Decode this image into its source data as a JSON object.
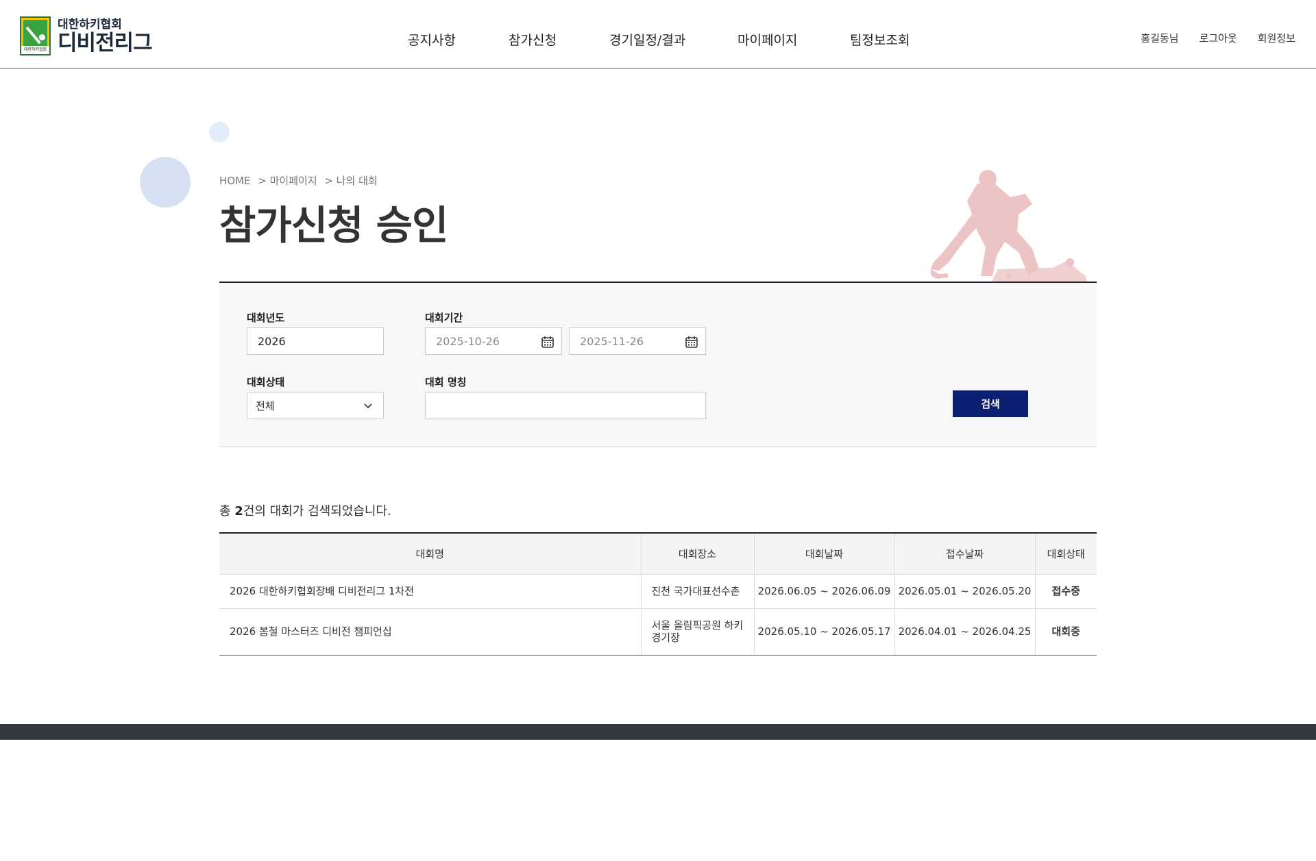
{
  "logo": {
    "sub": "대한하키협회",
    "main": "디비전리그",
    "mark_text": "대한하키협회"
  },
  "nav": {
    "items": [
      "공지사항",
      "참가신청",
      "경기일정/결과",
      "마이페이지",
      "팀정보조회"
    ]
  },
  "util": {
    "user": "홍길동님",
    "logout": "로그아웃",
    "member_info": "회원정보"
  },
  "breadcrumb": [
    "HOME",
    "> 마이페이지",
    "> 나의 대회"
  ],
  "page_title": "참가신청 승인",
  "search": {
    "year_label": "대회년도",
    "year_value": "2026",
    "period_label": "대회기간",
    "period_start": "2025-10-26",
    "period_end": "2025-11-26",
    "status_label": "대회상태",
    "status_value": "전체",
    "name_label": "대회 명칭",
    "name_value": "",
    "button": "검색"
  },
  "result": {
    "prefix": "총 ",
    "count": "2",
    "suffix": "건의 대회가 검색되었습니다."
  },
  "table": {
    "headers": [
      "대회명",
      "대회장소",
      "대회날짜",
      "접수날짜",
      "대회상태"
    ],
    "rows": [
      {
        "name": "2026 대한하키협회장배 디비전리그 1차전",
        "place": "진천 국가대표선수촌",
        "date": "2026.06.05 ~ 2026.06.09",
        "receipt": "2026.05.01 ~ 2026.05.20",
        "status": "접수중"
      },
      {
        "name": "2026 봄철 마스터즈 디비전 챔피언십",
        "place": "서울 올림픽공원 하키경기장",
        "date": "2026.05.10 ~ 2026.05.17",
        "receipt": "2026.04.01 ~ 2026.04.25",
        "status": "대회중"
      }
    ]
  },
  "colors": {
    "primary_button": "#0a1f6f",
    "status_text": "#e0961a",
    "footer": "#333842",
    "player_silhouette": "#ecc4c4"
  },
  "icons": [
    "calendar-icon",
    "chevron-down-icon",
    "hockey-player-illustration"
  ]
}
